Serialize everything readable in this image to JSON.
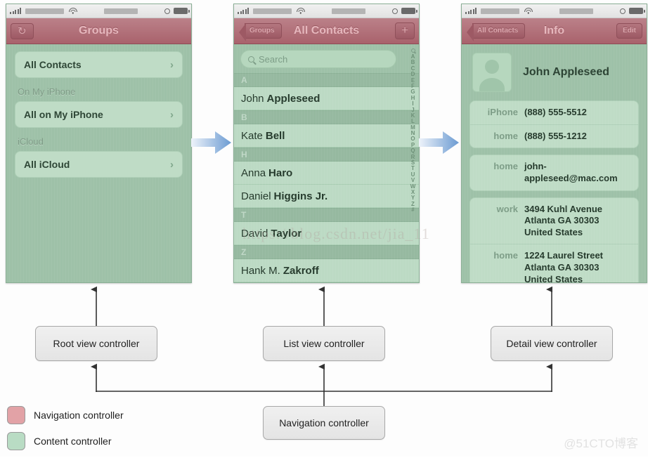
{
  "statusbar": {
    "signal_icon": "signal-bars-icon",
    "wifi_icon": "wifi-icon",
    "alarm_icon": "alarm-circle-icon",
    "battery_icon": "battery-icon"
  },
  "phones": {
    "root": {
      "nav": {
        "title": "Groups",
        "left_button": "↻",
        "left_button_name": "refresh-button"
      },
      "cells": [
        {
          "label": "All Contacts",
          "chevron": "›"
        },
        {
          "label": "All on My iPhone",
          "chevron": "›"
        },
        {
          "label": "All iCloud",
          "chevron": "›"
        }
      ],
      "headers": [
        "On My iPhone",
        "iCloud"
      ]
    },
    "list": {
      "nav": {
        "back": "Groups",
        "title": "All Contacts",
        "add": "+"
      },
      "search": {
        "placeholder": "Search",
        "icon": "search-icon"
      },
      "sections": [
        {
          "letter": "A",
          "rows": [
            {
              "first": "John",
              "last": "Appleseed"
            }
          ]
        },
        {
          "letter": "B",
          "rows": [
            {
              "first": "Kate",
              "last": "Bell"
            }
          ]
        },
        {
          "letter": "H",
          "rows": [
            {
              "first": "Anna",
              "last": "Haro"
            },
            {
              "first": "Daniel",
              "last": "Higgins Jr."
            }
          ]
        },
        {
          "letter": "T",
          "rows": [
            {
              "first": "David",
              "last": "Taylor"
            }
          ]
        },
        {
          "letter": "Z",
          "rows": [
            {
              "first": "Hank M.",
              "last": "Zakroff"
            }
          ]
        }
      ],
      "index": [
        "A",
        "B",
        "C",
        "D",
        "E",
        "F",
        "G",
        "H",
        "I",
        "J",
        "K",
        "L",
        "M",
        "N",
        "O",
        "P",
        "Q",
        "R",
        "S",
        "T",
        "U",
        "V",
        "W",
        "X",
        "Y",
        "Z",
        "#"
      ]
    },
    "detail": {
      "nav": {
        "back": "All Contacts",
        "title": "Info",
        "edit": "Edit"
      },
      "name": "John Appleseed",
      "avatar_icon": "person-silhouette-icon",
      "cards": [
        {
          "rows": [
            {
              "label": "iPhone",
              "value": "(888) 555-5512"
            },
            {
              "label": "home",
              "value": "(888) 555-1212"
            }
          ]
        },
        {
          "rows": [
            {
              "label": "home",
              "value": "john-appleseed@mac.com"
            }
          ]
        },
        {
          "rows": [
            {
              "label": "work",
              "value": "3494 Kuhl Avenue\nAtlanta GA 30303\nUnited States"
            },
            {
              "label": "home",
              "value": "1224 Laurel Street\nAtlanta GA 30303\nUnited States"
            }
          ]
        }
      ]
    }
  },
  "diagram": {
    "boxes": {
      "root": "Root view controller",
      "list": "List view controller",
      "detail": "Detail view controller",
      "nav": "Navigation controller"
    },
    "legend": [
      {
        "label": "Navigation controller",
        "color": "#e2a2a6"
      },
      {
        "label": "Content controller",
        "color": "#b9dcc4"
      }
    ]
  },
  "watermarks": {
    "middle": "https://blog.csdn.net/jia_11",
    "bottom_right": "@51CTO博客"
  },
  "colors": {
    "nav_bar": "#a9626c",
    "content_green": "#9ec1a8",
    "cell_green": "#bfdcc6",
    "arrow_blue": "#6b9bd2"
  }
}
